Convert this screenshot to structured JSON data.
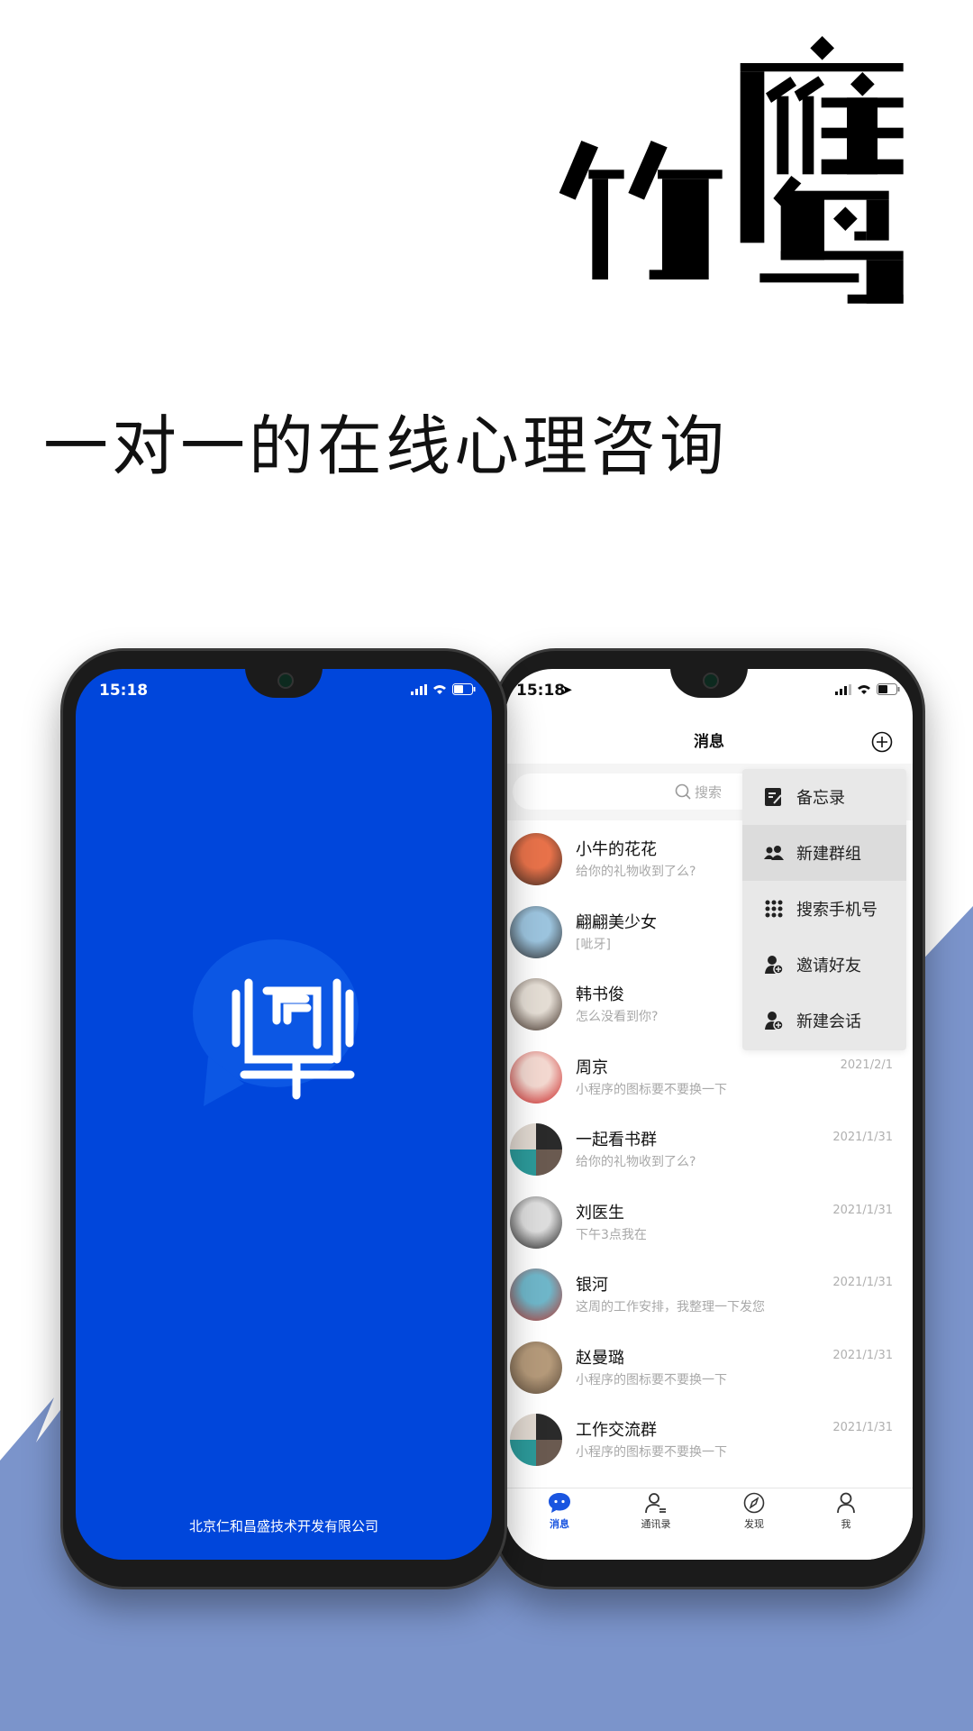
{
  "brand": {
    "logo_text": "竹鹰",
    "headline": "一对一的在线心理咨询",
    "background_color": "#7b94cb"
  },
  "splash": {
    "status_time": "15:18",
    "company": "北京仁和昌盛技术开发有限公司",
    "bg_color": "#0046db",
    "logo_icon": "chat-bubble-logo-icon"
  },
  "chat_app": {
    "status_time": "15:18",
    "title": "消息",
    "search_placeholder": "搜索",
    "menu": [
      {
        "label": "备忘录",
        "icon": "memo-icon"
      },
      {
        "label": "新建群组",
        "icon": "group-icon",
        "highlighted": true
      },
      {
        "label": "搜索手机号",
        "icon": "dialpad-icon"
      },
      {
        "label": "邀请好友",
        "icon": "add-user-icon"
      },
      {
        "label": "新建会话",
        "icon": "add-user-icon"
      }
    ],
    "conversations": [
      {
        "name": "小牛的花花",
        "message": "给你的礼物收到了么?",
        "date": ""
      },
      {
        "name": "翩翩美少女",
        "message": "[呲牙]",
        "date": ""
      },
      {
        "name": "韩书俊",
        "message": "怎么没看到你?",
        "date": ""
      },
      {
        "name": "周京",
        "message": "小程序的图标要不要换一下",
        "date": "2021/2/1"
      },
      {
        "name": "一起看书群",
        "message": "给你的礼物收到了么?",
        "date": "2021/1/31"
      },
      {
        "name": "刘医生",
        "message": "下午3点我在",
        "date": "2021/1/31"
      },
      {
        "name": "银河",
        "message": "这周的工作安排，我整理一下发您",
        "date": "2021/1/31"
      },
      {
        "name": "赵曼璐",
        "message": "小程序的图标要不要换一下",
        "date": "2021/1/31"
      },
      {
        "name": "工作交流群",
        "message": "小程序的图标要不要换一下",
        "date": "2021/1/31"
      }
    ],
    "tabs": [
      {
        "label": "消息",
        "active": true
      },
      {
        "label": "通讯录"
      },
      {
        "label": "发现"
      },
      {
        "label": "我"
      }
    ],
    "accent": "#1a55e0"
  }
}
